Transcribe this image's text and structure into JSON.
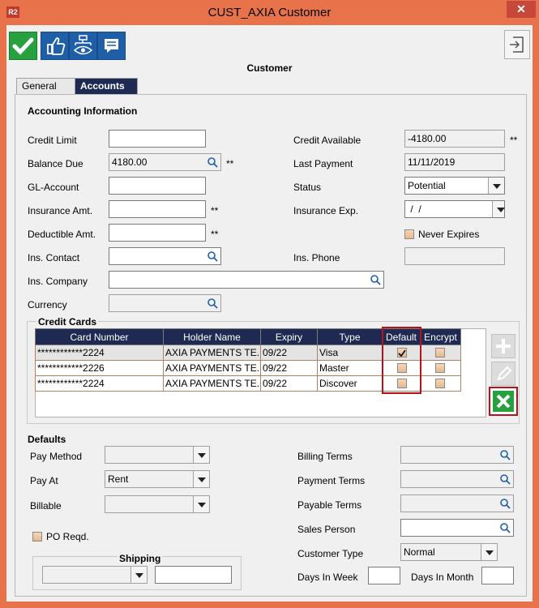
{
  "window": {
    "app_badge": "R2",
    "title": "CUST_AXIA Customer",
    "close_label": "✕"
  },
  "toolbar": {
    "save_icon": "checkmark-icon",
    "approve_icon": "thumbs-up-icon",
    "view_icon": "eye-network-icon",
    "notes_icon": "comment-icon",
    "exit_icon": "exit-icon"
  },
  "header": {
    "title": "Customer"
  },
  "tabs": [
    {
      "label": "General"
    },
    {
      "label": "Accounts"
    }
  ],
  "accounting": {
    "section_label": "Accounting Information",
    "credit_limit": {
      "label": "Credit Limit",
      "value": ""
    },
    "credit_available": {
      "label": "Credit Available",
      "value": "-4180.00",
      "note": "**"
    },
    "balance_due": {
      "label": "Balance Due",
      "value": "4180.00",
      "note": "**"
    },
    "last_payment": {
      "label": "Last Payment",
      "value": "11/11/2019"
    },
    "gl_account": {
      "label": "GL-Account",
      "value": ""
    },
    "status": {
      "label": "Status",
      "value": "Potential"
    },
    "insurance_amt": {
      "label": "Insurance Amt.",
      "value": "",
      "note": "**"
    },
    "insurance_exp": {
      "label": "Insurance Exp.",
      "value": " /  /"
    },
    "deductible_amt": {
      "label": "Deductible Amt.",
      "value": "",
      "note": "**"
    },
    "never_expires": {
      "label": "Never Expires"
    },
    "ins_contact": {
      "label": "Ins. Contact",
      "value": ""
    },
    "ins_phone": {
      "label": "Ins. Phone",
      "value": ""
    },
    "ins_company": {
      "label": "Ins. Company",
      "value": ""
    },
    "currency": {
      "label": "Currency",
      "value": ""
    }
  },
  "credit_cards": {
    "section_label": "Credit Cards",
    "columns": [
      "Card Number",
      "Holder Name",
      "Expiry",
      "Type",
      "Default",
      "Encrypt"
    ],
    "rows": [
      {
        "card_number": "************2224",
        "holder": "AXIA PAYMENTS TE...",
        "expiry": "09/22",
        "type": "Visa",
        "default": true,
        "encrypt": false
      },
      {
        "card_number": "************2226",
        "holder": "AXIA PAYMENTS TE...",
        "expiry": "09/22",
        "type": "Master",
        "default": false,
        "encrypt": false
      },
      {
        "card_number": "************2224",
        "holder": "AXIA PAYMENTS TE...",
        "expiry": "09/22",
        "type": "Discover",
        "default": false,
        "encrypt": false
      }
    ],
    "add_icon": "plus-icon",
    "edit_icon": "pencil-icon",
    "delete_icon": "x-icon"
  },
  "defaults": {
    "section_label": "Defaults",
    "pay_method": {
      "label": "Pay Method",
      "value": ""
    },
    "pay_at": {
      "label": "Pay At",
      "value": "Rent"
    },
    "billable": {
      "label": "Billable",
      "value": ""
    },
    "po_reqd": {
      "label": "PO Reqd."
    },
    "shipping": {
      "label": "Shipping",
      "value": "",
      "extra": ""
    },
    "billing_terms": {
      "label": "Billing Terms",
      "value": ""
    },
    "payment_terms": {
      "label": "Payment Terms",
      "value": ""
    },
    "payable_terms": {
      "label": "Payable Terms",
      "value": ""
    },
    "sales_person": {
      "label": "Sales Person",
      "value": ""
    },
    "customer_type": {
      "label": "Customer Type",
      "value": "Normal"
    },
    "days_in_week": {
      "label": "Days In Week",
      "value": ""
    },
    "days_in_month": {
      "label": "Days In Month",
      "value": ""
    }
  },
  "colors": {
    "accent_navy": "#1e2a52",
    "window_frame": "#e8734a",
    "highlight_red": "#b5121b",
    "save_green": "#27a040",
    "toolbar_blue": "#1f5fa8"
  }
}
